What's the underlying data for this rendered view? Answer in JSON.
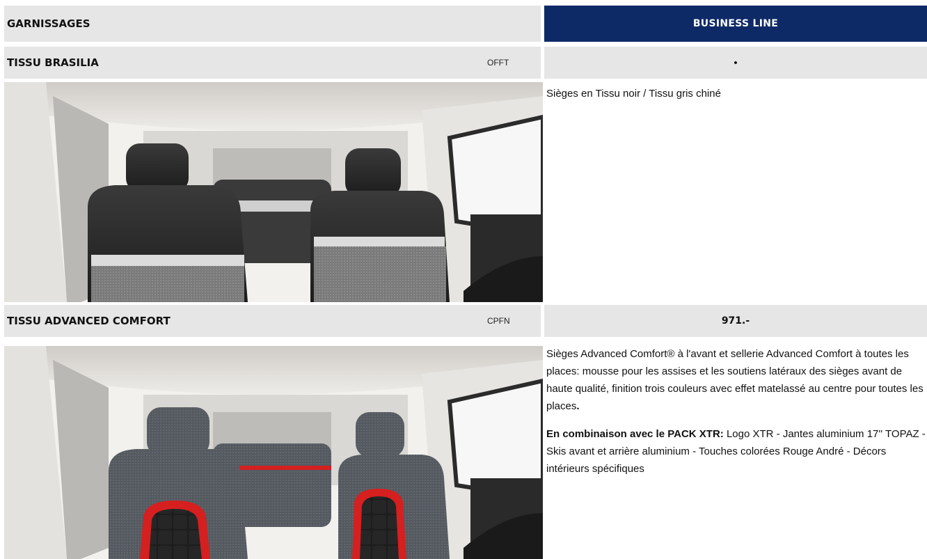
{
  "header": {
    "left_title": "GARNISSAGES",
    "right_title": "BUSINESS LINE",
    "right_bg": "#0e2a66"
  },
  "rows": [
    {
      "name": "TISSU BRASILIA",
      "code": "OFFT",
      "value": "•",
      "description": [
        "Sièges en Tissu noir / Tissu gris chiné"
      ]
    },
    {
      "name": "TISSU ADVANCED COMFORT",
      "code": "CPFN",
      "value": "971.-",
      "description": [
        "Sièges Advanced Comfort® à l'avant et sellerie Advanced Comfort à toutes les places: mousse pour les assises et les soutiens latéraux des sièges avant de haute qualité, finition trois couleurs avec effet matelassé au centre pour toutes les places",
        "."
      ],
      "combo_label": "En combinaison avec le PACK XTR:",
      "combo_text": " Logo XTR - Jantes aluminium 17'' TOPAZ - Skis avant et arrière aluminium - Touches colorées Rouge André - Décors intérieurs spécifiques"
    }
  ],
  "images": [
    {
      "icon": "car-interior-fabric-seats-image",
      "accent": "#e8e8e8"
    },
    {
      "icon": "car-interior-advanced-comfort-seats-image",
      "accent": "#d61f1f"
    }
  ]
}
